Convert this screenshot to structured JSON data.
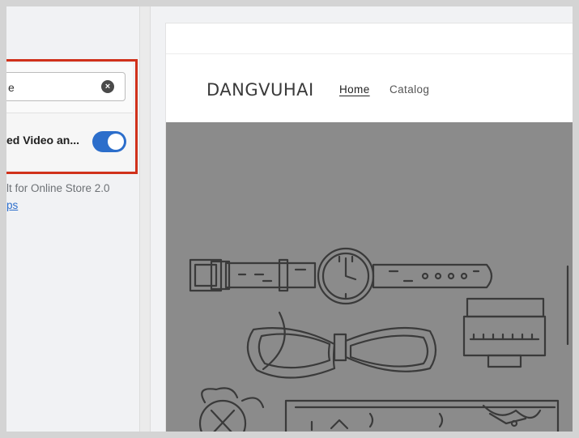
{
  "editor": {
    "search": {
      "value": "e",
      "clear_icon": "close-circle-icon"
    },
    "toggle": {
      "label": "ed Video an...",
      "state": "on",
      "color": "#2c6ecb"
    },
    "info_text": "lt for Online Store 2.0",
    "info_link": "ps",
    "highlight_color": "#d0311b"
  },
  "preview": {
    "store_name": "DANGVUHAI",
    "nav": {
      "home": "Home",
      "catalog": "Catalog"
    },
    "hero_background": "#8b8b8b"
  }
}
